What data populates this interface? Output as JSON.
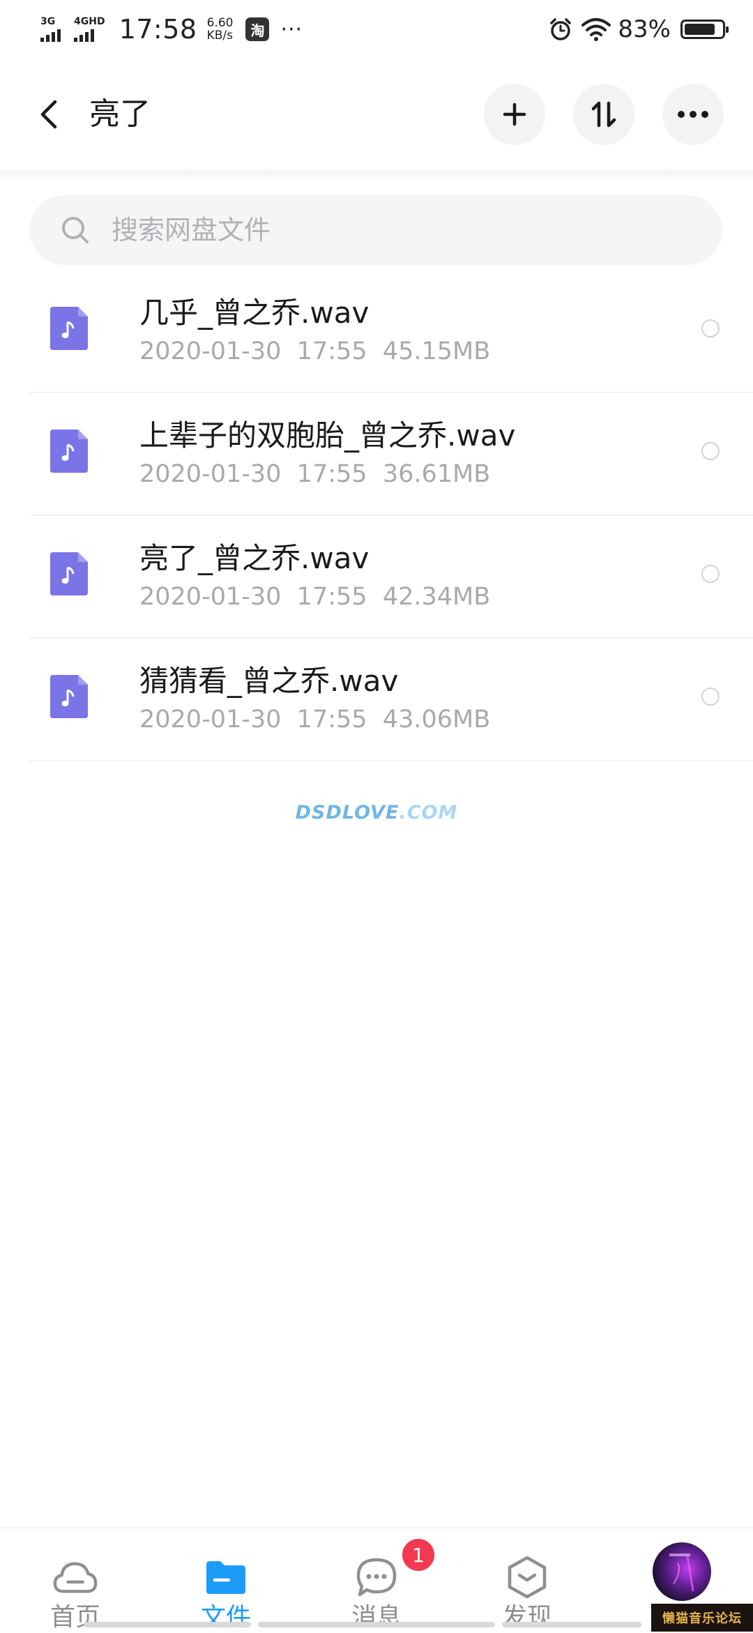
{
  "status_bar": {
    "signal1_label": "3G",
    "signal2_label": "4GHD",
    "time": "17:58",
    "speed_value": "6.60",
    "speed_unit": "KB/s",
    "app_badge": "淘",
    "more_dots": "···",
    "battery_percent": "83%",
    "battery_level": 0.83
  },
  "header": {
    "title": "亮了",
    "back_icon": "chevron-left-icon",
    "add_icon": "plus-icon",
    "sort_icon": "sort-icon",
    "more_icon": "more-icon"
  },
  "search": {
    "placeholder": "搜索网盘文件"
  },
  "files": [
    {
      "name": "几乎_曾之乔.wav",
      "date": "2020-01-30",
      "time": "17:55",
      "size": "45.15MB",
      "icon": "music-file-icon"
    },
    {
      "name": "上辈子的双胞胎_曾之乔.wav",
      "date": "2020-01-30",
      "time": "17:55",
      "size": "36.61MB",
      "icon": "music-file-icon"
    },
    {
      "name": "亮了_曾之乔.wav",
      "date": "2020-01-30",
      "time": "17:55",
      "size": "42.34MB",
      "icon": "music-file-icon"
    },
    {
      "name": "猜猜看_曾之乔.wav",
      "date": "2020-01-30",
      "time": "17:55",
      "size": "43.06MB",
      "icon": "music-file-icon"
    }
  ],
  "watermark": {
    "part1": "DSDLOVE",
    "part2": ".COM"
  },
  "bottom_nav": {
    "items": [
      {
        "label": "首页",
        "icon": "cloud-icon",
        "active": false
      },
      {
        "label": "文件",
        "icon": "folder-icon",
        "active": true
      },
      {
        "label": "消息",
        "icon": "chat-icon",
        "active": false,
        "badge": "1"
      },
      {
        "label": "发现",
        "icon": "discover-icon",
        "active": false
      },
      {
        "label": "",
        "icon": "avatar",
        "active": false
      }
    ]
  },
  "stamp": "懒猫音乐论坛",
  "colors": {
    "accent": "#1c9cf6",
    "file_icon": "#7b74e6",
    "badge": "#f2394f"
  }
}
